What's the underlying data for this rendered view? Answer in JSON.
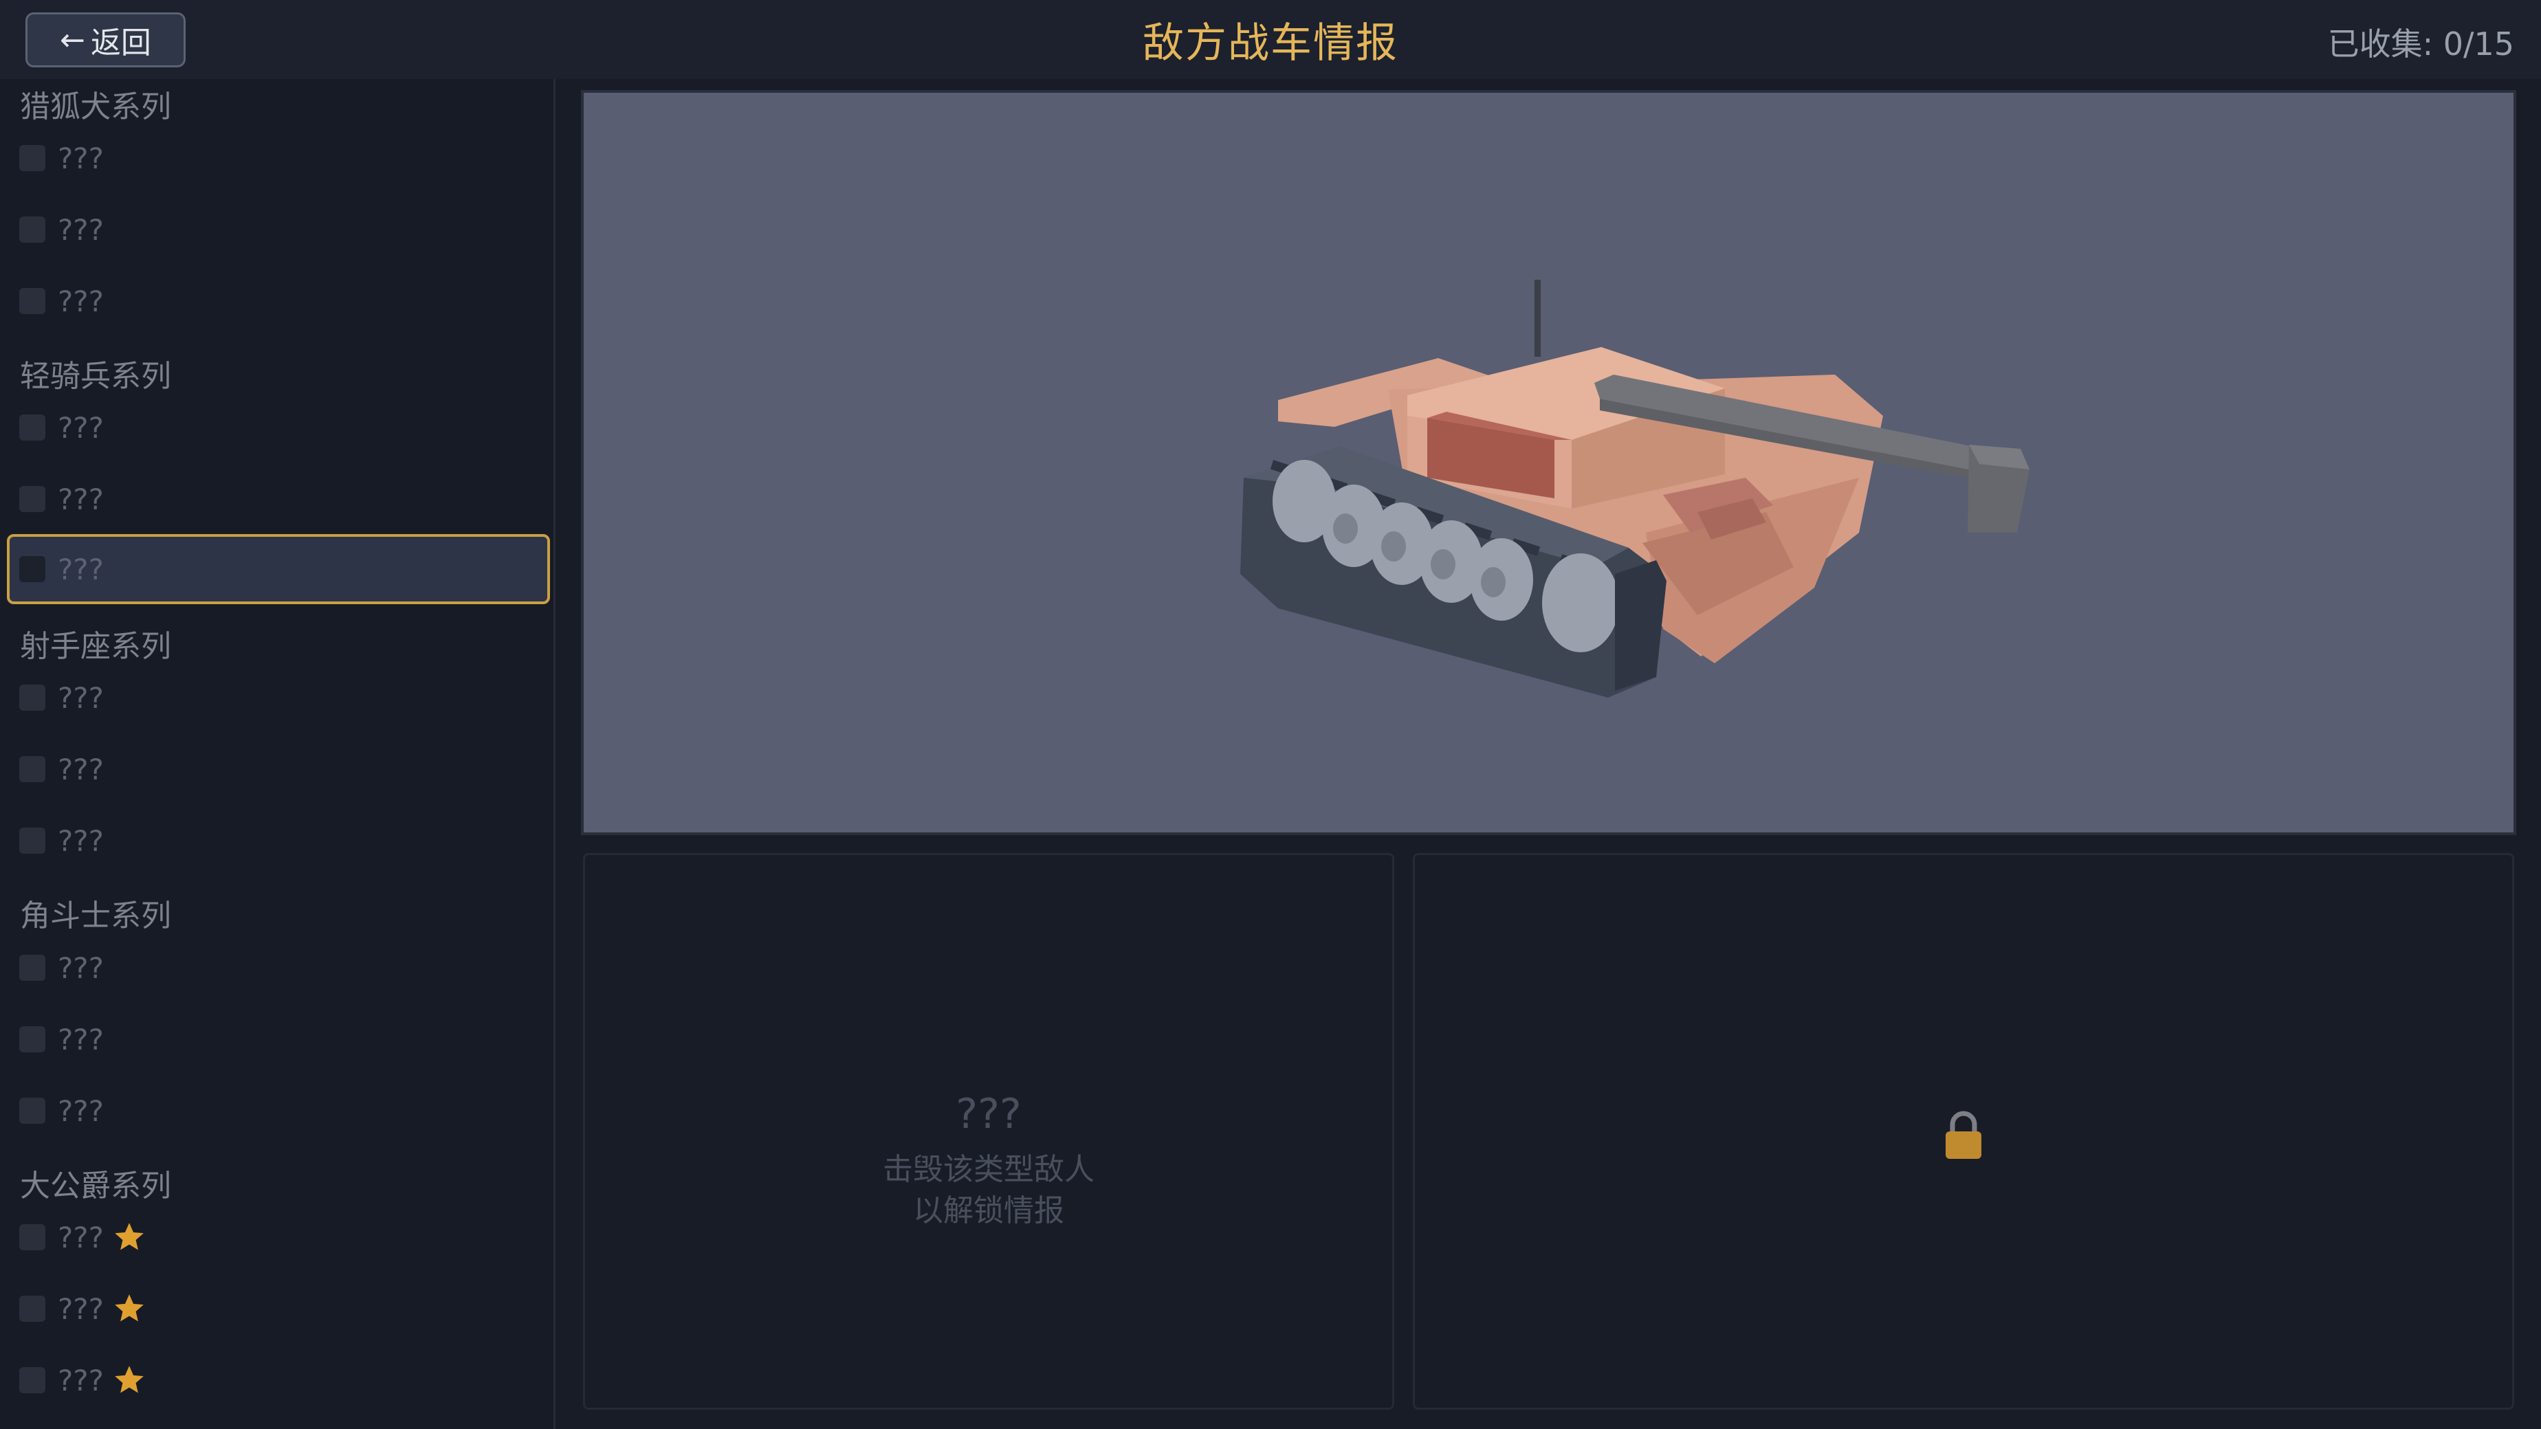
{
  "header": {
    "back_label": "返回",
    "title": "敌方战车情报",
    "collected": "已收集: 0/15"
  },
  "sidebar": {
    "groups": [
      {
        "title": "猎狐犬系列",
        "entries": [
          {
            "name": "???"
          },
          {
            "name": "???"
          },
          {
            "name": "???"
          }
        ]
      },
      {
        "title": "轻骑兵系列",
        "entries": [
          {
            "name": "???"
          },
          {
            "name": "???"
          },
          {
            "name": "???",
            "selected": true
          }
        ]
      },
      {
        "title": "射手座系列",
        "entries": [
          {
            "name": "???"
          },
          {
            "name": "???"
          },
          {
            "name": "???"
          }
        ]
      },
      {
        "title": "角斗士系列",
        "entries": [
          {
            "name": "???"
          },
          {
            "name": "???"
          },
          {
            "name": "???"
          }
        ]
      },
      {
        "title": "大公爵系列",
        "entries": [
          {
            "name": "???",
            "star": true
          },
          {
            "name": "???",
            "star": true
          },
          {
            "name": "???",
            "star": true
          }
        ]
      }
    ]
  },
  "detail": {
    "name": "???",
    "hint_line1": "击毁该类型敌人",
    "hint_line2": "以解锁情报"
  },
  "colors": {
    "accent": "#e5b65a",
    "selected_border": "#c9a043",
    "star": "#e0a030",
    "lock": "#c08a2e",
    "preview_bg": "#595e72",
    "tank_body": "#d9a08a"
  },
  "icons": {
    "back": "left-arrow-icon",
    "star": "star-icon",
    "lock": "lock-icon"
  }
}
